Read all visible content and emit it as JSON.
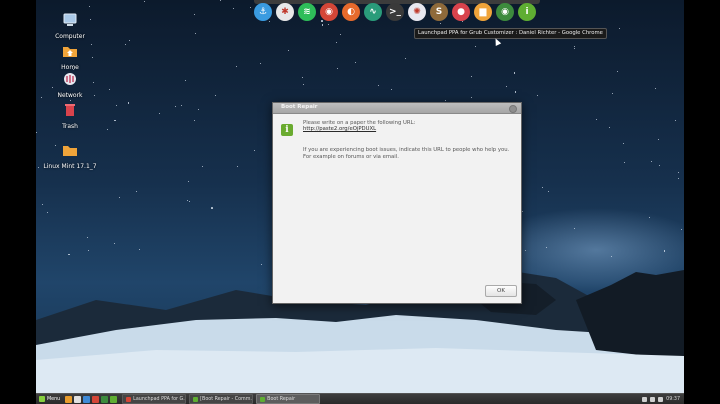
{
  "desktop": {
    "icons": [
      {
        "label": "Computer",
        "icon": "computer-icon"
      },
      {
        "label": "Home",
        "icon": "folder-home-icon"
      },
      {
        "label": "Network",
        "icon": "network-icon"
      },
      {
        "label": "Trash",
        "icon": "trash-icon"
      },
      {
        "label": "Linux Mint 17.1_7",
        "icon": "folder-icon"
      }
    ]
  },
  "dock": {
    "items": [
      {
        "name": "anchor-icon",
        "color": "#3a9be0",
        "glyph": "⚓"
      },
      {
        "name": "multicolor-app-icon",
        "color": "#e8e8e8",
        "glyph": "✱"
      },
      {
        "name": "spotify-icon",
        "color": "#2ebd59",
        "glyph": "≋"
      },
      {
        "name": "chrome-icon",
        "color": "#d44637",
        "glyph": "◉"
      },
      {
        "name": "firefox-icon",
        "color": "#e66a2c",
        "glyph": "◐"
      },
      {
        "name": "system-monitor-icon",
        "color": "#2a9c7a",
        "glyph": "∿"
      },
      {
        "name": "terminal-icon",
        "color": "#3a3a3a",
        "glyph": ">_"
      },
      {
        "name": "settings-wheel-icon",
        "color": "#e8e8f0",
        "glyph": "✺"
      },
      {
        "name": "sublime-text-icon",
        "color": "#8f6a3a",
        "glyph": "S"
      },
      {
        "name": "record-icon",
        "color": "#d9434c",
        "glyph": "●"
      },
      {
        "name": "files-folder-icon",
        "color": "#f0a43a",
        "glyph": "▆"
      },
      {
        "name": "chrome-icon",
        "color": "#3d8b3d",
        "glyph": "◉"
      },
      {
        "name": "info-app-icon",
        "color": "#5fae32",
        "glyph": "i"
      }
    ],
    "tooltip": "Launchpad PPA for Grub Customizer : Daniel Richter - Google Chrome"
  },
  "dialog": {
    "title": "Boot Repair",
    "line1": "Please write on a paper the following URL:",
    "url": "http://paste2.org/eOjPDUXL",
    "help": "If you are experiencing boot issues, indicate this URL to people who help you. For example on forums or via email.",
    "ok_label": "OK"
  },
  "panel": {
    "menu_label": "Menu",
    "launchers": [
      "#e89c2c",
      "#e0e0e0",
      "#3f8ad6",
      "#d44637",
      "#3d8b3d",
      "#5fae32"
    ],
    "tasks": [
      {
        "label": "Launchpad PPA for G...",
        "color": "#d44637",
        "active": false
      },
      {
        "label": "[Boot Repair - Comm...",
        "color": "#5fae32",
        "active": false
      },
      {
        "label": "Boot Repair",
        "color": "#5fae32",
        "active": true
      }
    ],
    "clock": "09:37"
  }
}
